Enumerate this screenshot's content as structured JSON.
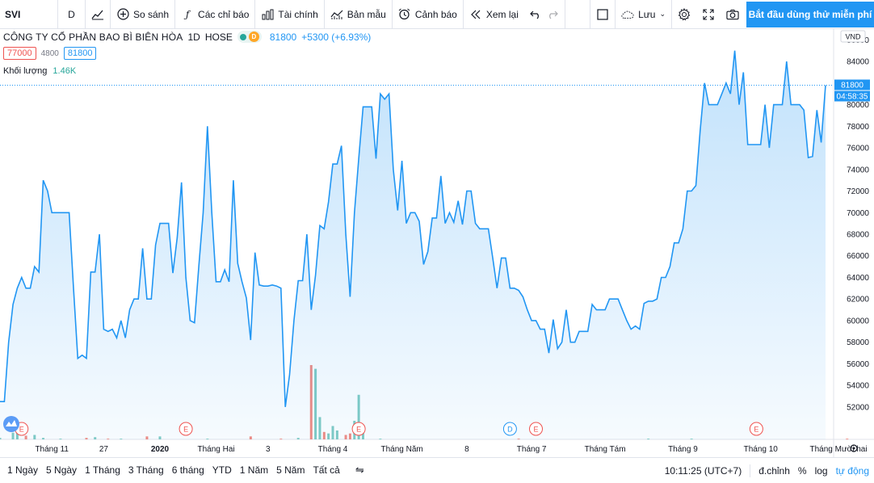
{
  "toolbar": {
    "symbol": "SVI",
    "interval": "D",
    "compare": "So sánh",
    "indicators": "Các chỉ báo",
    "financials": "Tài chính",
    "templates": "Bản mẫu",
    "alerts": "Cảnh báo",
    "replay": "Xem lại",
    "save": "Lưu",
    "cta": "Bắt đầu dùng thử miễn phí"
  },
  "legend": {
    "title": "CÔNG TY CỔ PHẦN BAO BÌ BIÊN HÒA",
    "interval": "1D",
    "exchange": "HOSE",
    "d_badge": "D",
    "price": "81800",
    "change": "+5300 (+6.93%)",
    "bid": "77000",
    "spread": "4800",
    "ask": "81800",
    "volume_label": "Khối lượng",
    "volume_value": "1.46K"
  },
  "axis": {
    "currency": "VND",
    "last_price": "81800",
    "countdown": "04:58:35"
  },
  "chart_data": {
    "type": "area",
    "y_ticks": [
      52000,
      54000,
      56000,
      58000,
      60000,
      62000,
      64000,
      66000,
      68000,
      70000,
      72000,
      74000,
      76000,
      78000,
      80000,
      82000,
      84000,
      86000
    ],
    "ylim": [
      49000,
      87000
    ],
    "x_tick_labels": [
      "Tháng 11",
      "27",
      "2020",
      "Tháng Hai",
      "3",
      "Tháng 4",
      "Tháng Năm",
      "8",
      "Tháng 7",
      "Tháng Tám",
      "Tháng 9",
      "Tháng 10",
      "Tháng Mười hai"
    ],
    "series": [
      {
        "values": [
          52500,
          52500,
          58000,
          61500,
          63000,
          64000,
          63000,
          63000,
          65000,
          64500,
          73000,
          72000,
          70000,
          70000,
          70000,
          70000,
          70000,
          63000,
          56500,
          56800,
          56500,
          64500,
          64500,
          68000,
          59200,
          59000,
          59200,
          58400,
          60000,
          58400,
          61000,
          62000,
          62000,
          66700,
          62000,
          62000,
          67000,
          69000,
          69000,
          69000,
          64400,
          67700,
          72800,
          64000,
          60000,
          59800,
          65000,
          70000,
          78000,
          70000,
          63600,
          63600,
          64700,
          63600,
          73000,
          65300,
          63600,
          62100,
          58200,
          66300,
          63300,
          63200,
          63200,
          63300,
          63200,
          63000,
          52000,
          55000,
          60000,
          63700,
          63700,
          68000,
          61000,
          64200,
          68800,
          68500,
          71000,
          74500,
          74500,
          76200,
          68000,
          62200,
          70000,
          75000,
          79800,
          79800,
          79800,
          75000,
          81000,
          80500,
          81000,
          74000,
          70200,
          74800,
          69000,
          70000,
          70000,
          69200,
          65200,
          66400,
          69500,
          69500,
          73400,
          69000,
          70000,
          69100,
          71100,
          68900,
          72000,
          72000,
          69000,
          68500,
          68500,
          68500,
          65800,
          63000,
          65800,
          65800,
          63000,
          63000,
          62800,
          62200,
          61000,
          60000,
          60000,
          59200,
          59200,
          57000,
          60100,
          57400,
          58000,
          61000,
          58000,
          58000,
          59000,
          59000,
          59000,
          61500,
          61000,
          61000,
          61000,
          62000,
          62000,
          62000,
          61000,
          60000,
          59200,
          59500,
          59200,
          61600,
          61800,
          61800,
          62000,
          64000,
          64000,
          65000,
          67200,
          67200,
          68500,
          72000,
          72000,
          72500,
          77600,
          82000,
          80000,
          80000,
          80000,
          81000,
          82000,
          81000,
          85000,
          80000,
          83000,
          76300,
          76300,
          76300,
          76300,
          80000,
          76000,
          80000,
          80000,
          80000,
          84000,
          80000,
          80000,
          80000,
          79500,
          75100,
          75200,
          79500,
          76500,
          81800
        ]
      }
    ],
    "volume": [
      {
        "i": 0,
        "v": 2
      },
      {
        "i": 3,
        "v": 9
      },
      {
        "i": 4,
        "v": 12
      },
      {
        "i": 6,
        "v": 5
      },
      {
        "i": 8,
        "v": 6
      },
      {
        "i": 10,
        "v": 2
      },
      {
        "i": 14,
        "v": 1
      },
      {
        "i": 20,
        "v": 2
      },
      {
        "i": 22,
        "v": 3
      },
      {
        "i": 25,
        "v": 1
      },
      {
        "i": 28,
        "v": 1
      },
      {
        "i": 34,
        "v": 4
      },
      {
        "i": 37,
        "v": 4
      },
      {
        "i": 48,
        "v": 1
      },
      {
        "i": 58,
        "v": 4
      },
      {
        "i": 65,
        "v": 1
      },
      {
        "i": 69,
        "v": 2
      },
      {
        "i": 72,
        "v": 100
      },
      {
        "i": 73,
        "v": 95
      },
      {
        "i": 74,
        "v": 30
      },
      {
        "i": 75,
        "v": 10
      },
      {
        "i": 76,
        "v": 8
      },
      {
        "i": 77,
        "v": 18
      },
      {
        "i": 78,
        "v": 12
      },
      {
        "i": 80,
        "v": 6
      },
      {
        "i": 81,
        "v": 8
      },
      {
        "i": 82,
        "v": 25
      },
      {
        "i": 83,
        "v": 60
      },
      {
        "i": 84,
        "v": 10
      },
      {
        "i": 88,
        "v": 1
      },
      {
        "i": 120,
        "v": 1
      },
      {
        "i": 150,
        "v": 1
      },
      {
        "i": 160,
        "v": 1
      },
      {
        "i": 196,
        "v": 1
      }
    ],
    "events": [
      {
        "label": "E",
        "color": "#ef5350",
        "i": 5
      },
      {
        "label": "E",
        "color": "#ef5350",
        "i": 43
      },
      {
        "label": "E",
        "color": "#ef5350",
        "i": 83
      },
      {
        "label": "D",
        "color": "#2196f3",
        "i": 118
      },
      {
        "label": "E",
        "color": "#ef5350",
        "i": 124
      },
      {
        "label": "E",
        "color": "#ef5350",
        "i": 175
      }
    ],
    "line_color": "#2196f3",
    "fill_color": "#2196f3"
  },
  "bottom": {
    "ranges": [
      "1 Ngày",
      "5 Ngày",
      "1 Tháng",
      "3 Tháng",
      "6 tháng",
      "YTD",
      "1 Năm",
      "5 Năm",
      "Tất cả"
    ],
    "time": "10:11:25 (UTC+7)",
    "adjust": "đ.chỉnh",
    "percent": "%",
    "log": "log",
    "auto": "tự động"
  }
}
